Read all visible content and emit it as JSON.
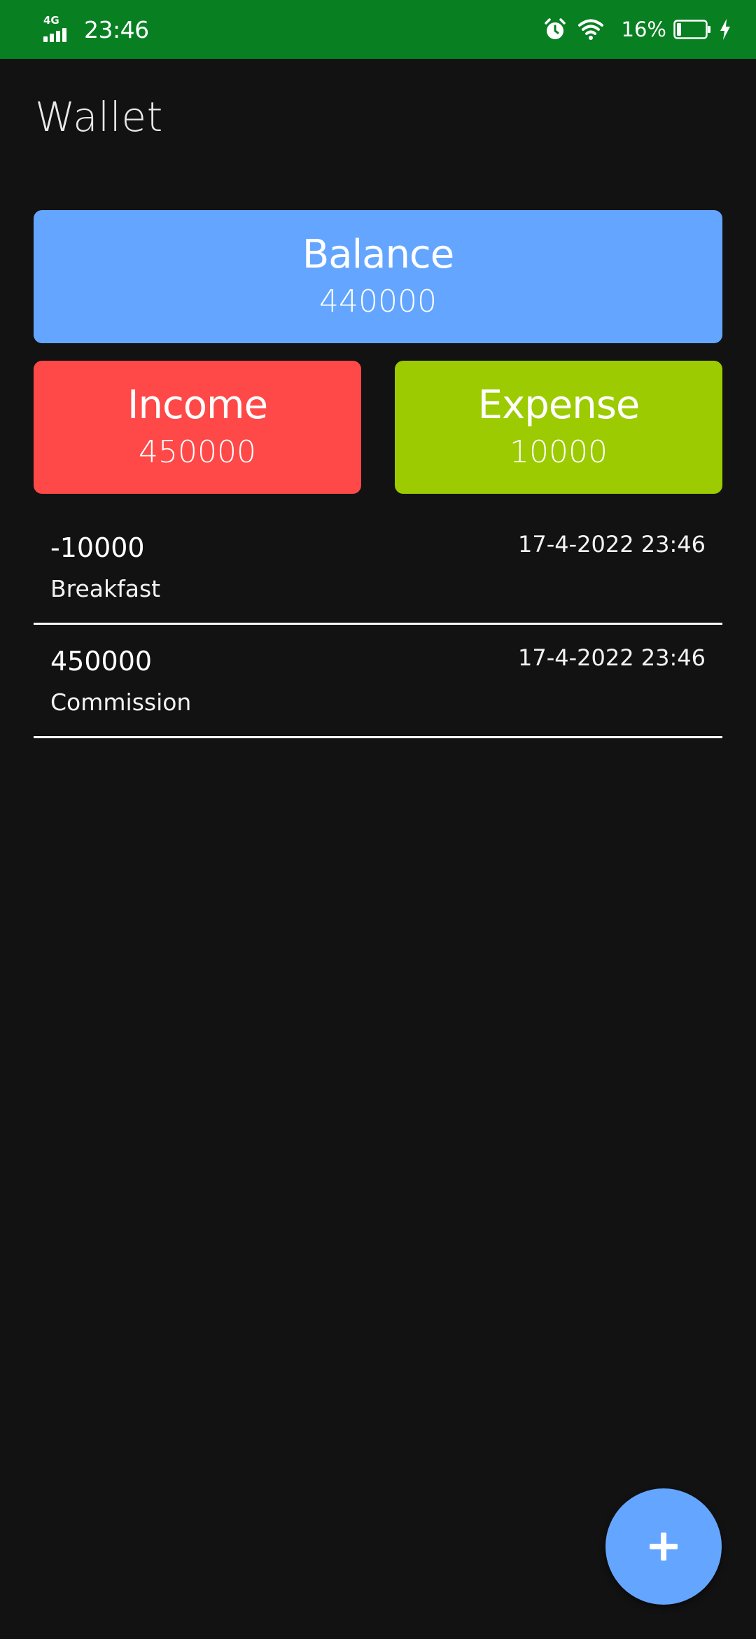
{
  "status_bar": {
    "network_type": "4G",
    "time": "23:46",
    "battery_percent": "16%",
    "battery_level": 0.16,
    "icons": [
      "signal-icon",
      "alarm-icon",
      "wifi-icon",
      "battery-icon",
      "charging-icon"
    ]
  },
  "app": {
    "title": "Wallet"
  },
  "summary": {
    "balance": {
      "label": "Balance",
      "value": "440000",
      "color": "#64a6ff"
    },
    "income": {
      "label": "Income",
      "value": "450000",
      "color": "#ff4848"
    },
    "expense": {
      "label": "Expense",
      "value": "10000",
      "color": "#9bcb00"
    }
  },
  "transactions": [
    {
      "amount": "-10000",
      "description": "Breakfast",
      "datetime": "17-4-2022 23:46"
    },
    {
      "amount": "450000",
      "description": "Commission",
      "datetime": "17-4-2022 23:46"
    }
  ],
  "fab": {
    "icon": "plus-icon",
    "color": "#64a6ff"
  },
  "colors": {
    "status_bar": "#088022",
    "background": "#121212"
  }
}
